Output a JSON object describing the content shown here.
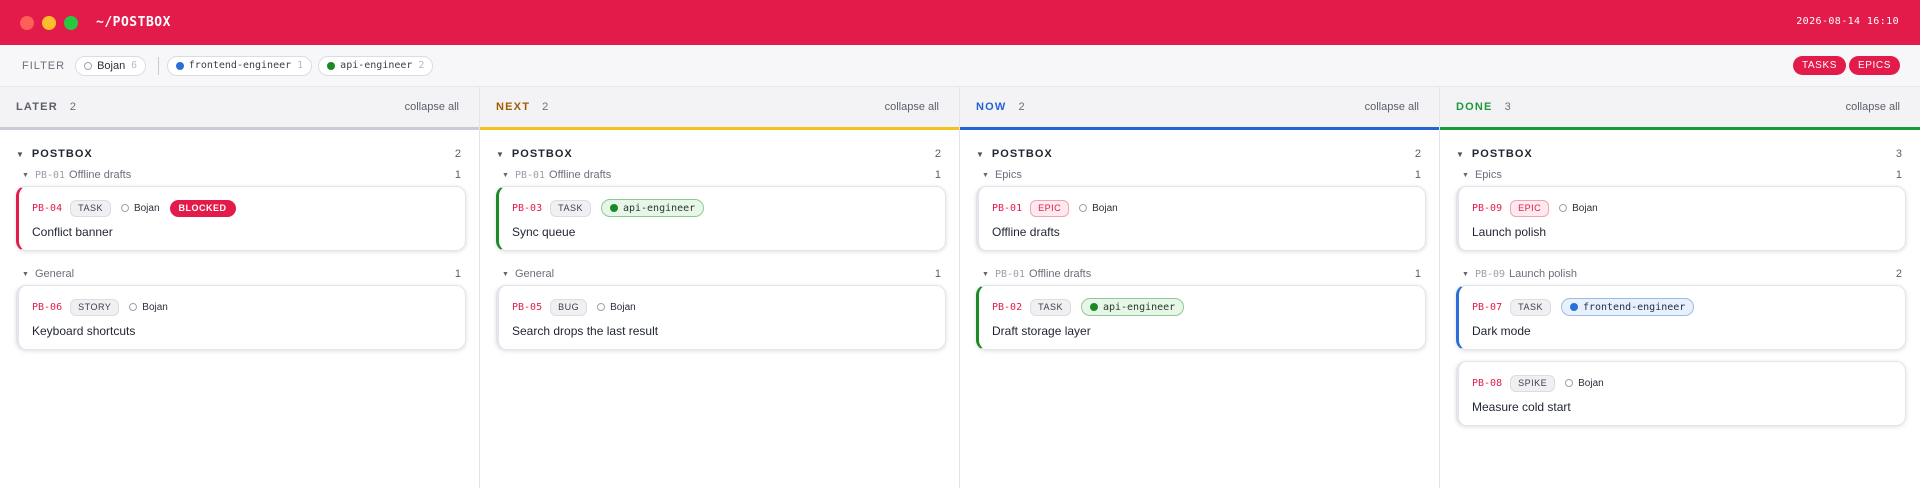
{
  "window": {
    "title": "~/POSTBOX",
    "clock": "2026-08-14 16:10"
  },
  "filter": {
    "label": "FILTER",
    "chips": [
      {
        "label": "Bojan",
        "count": "6"
      },
      {
        "label": "frontend-engineer",
        "count": "1"
      },
      {
        "label": "api-engineer",
        "count": "2"
      }
    ]
  },
  "view_toggle": {
    "tasks": "TASKS",
    "epics": "EPICS"
  },
  "colors": {
    "brand": "#e31b4a",
    "later": "#c8ccd6",
    "next": "#f2c31b",
    "now": "#2463d6",
    "done": "#1c9a3a"
  },
  "columns": [
    {
      "title": "LATER",
      "count": "2",
      "collapse": "collapse all",
      "group": {
        "title": "POSTBOX",
        "count": "2"
      },
      "subgroups": [
        {
          "key": "PB-01",
          "title": "Offline drafts",
          "count": "1",
          "cards": [
            {
              "key": "PB-04",
              "type": "TASK",
              "assignee": "Bojan",
              "flag": "BLOCKED",
              "title": "Conflict banner",
              "accent": "#e31b4a"
            }
          ]
        },
        {
          "key": "",
          "title": "General",
          "count": "1",
          "cards": [
            {
              "key": "PB-06",
              "type": "STORY",
              "assignee": "Bojan",
              "title": "Keyboard shortcuts",
              "accent": "#e4e5ea"
            }
          ]
        }
      ]
    },
    {
      "title": "NEXT",
      "count": "2",
      "collapse": "collapse all",
      "group": {
        "title": "POSTBOX",
        "count": "2"
      },
      "subgroups": [
        {
          "key": "PB-01",
          "title": "Offline drafts",
          "count": "1",
          "cards": [
            {
              "key": "PB-03",
              "type": "TASK",
              "assignee": "api-engineer",
              "title": "Sync queue",
              "accent": "#1b8a26"
            }
          ]
        },
        {
          "key": "",
          "title": "General",
          "count": "1",
          "cards": [
            {
              "key": "PB-05",
              "type": "BUG",
              "assignee": "Bojan",
              "title": "Search drops the last result",
              "accent": "#e4e5ea"
            }
          ]
        }
      ]
    },
    {
      "title": "NOW",
      "count": "2",
      "collapse": "collapse all",
      "group": {
        "title": "POSTBOX",
        "count": "2"
      },
      "subgroups": [
        {
          "key": "",
          "title": "Epics",
          "count": "1",
          "cards": [
            {
              "key": "PB-01",
              "type": "EPIC",
              "assignee": "Bojan",
              "title": "Offline drafts",
              "accent": "#e4e5ea"
            }
          ]
        },
        {
          "key": "PB-01",
          "title": "Offline drafts",
          "count": "1",
          "cards": [
            {
              "key": "PB-02",
              "type": "TASK",
              "assignee": "api-engineer",
              "title": "Draft storage layer",
              "accent": "#1b8a26"
            }
          ]
        }
      ]
    },
    {
      "title": "DONE",
      "count": "3",
      "collapse": "collapse all",
      "group": {
        "title": "POSTBOX",
        "count": "3"
      },
      "subgroups": [
        {
          "key": "",
          "title": "Epics",
          "count": "1",
          "cards": [
            {
              "key": "PB-09",
              "type": "EPIC",
              "assignee": "Bojan",
              "title": "Launch polish",
              "accent": "#e4e5ea"
            }
          ]
        },
        {
          "key": "PB-09",
          "title": "Launch polish",
          "count": "2",
          "cards": [
            {
              "key": "PB-07",
              "type": "TASK",
              "assignee": "frontend-engineer",
              "title": "Dark mode",
              "accent": "#2a6fd8"
            },
            {
              "key": "PB-08",
              "type": "SPIKE",
              "assignee": "Bojan",
              "title": "Measure cold start",
              "accent": "#e4e5ea"
            }
          ]
        }
      ]
    }
  ]
}
